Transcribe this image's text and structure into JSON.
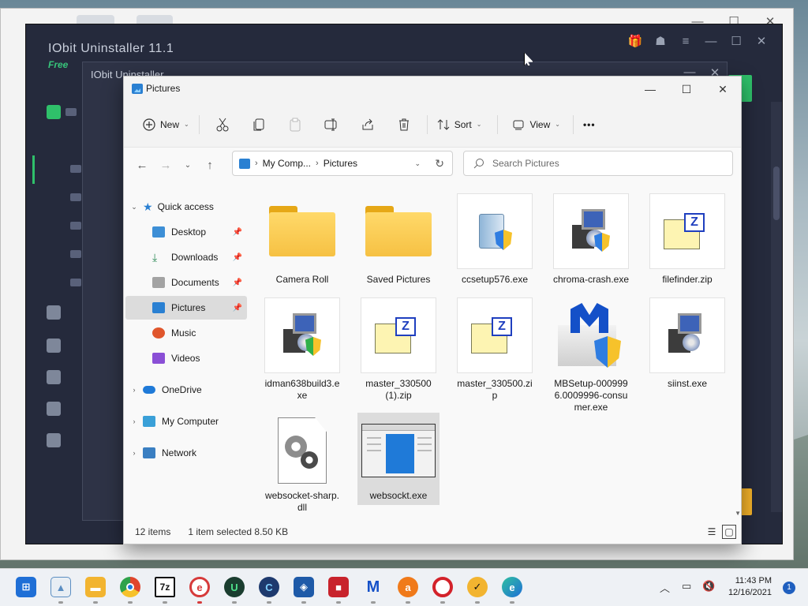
{
  "back_window": {
    "controls": [
      "—",
      "☐",
      "✕"
    ]
  },
  "iobit": {
    "title": "IObit Uninstaller 11.1",
    "edition": "Free",
    "controls": [
      "—",
      "☐",
      "✕"
    ],
    "dialog": {
      "title": "IObit Uninstaller",
      "controls": [
        "—",
        "✕"
      ]
    }
  },
  "explorer": {
    "title": "Pictures",
    "controls": [
      "—",
      "☐",
      "✕"
    ],
    "commands": {
      "new_label": "New",
      "sort_label": "Sort",
      "view_label": "View",
      "more_label": "•••"
    },
    "address": {
      "segments": [
        "My Comp...",
        "Pictures"
      ]
    },
    "search": {
      "placeholder": "Search Pictures"
    },
    "nav": {
      "quick_access": "Quick access",
      "items": [
        {
          "label": "Desktop",
          "icon": "desktop-icon",
          "color": "#3d8fd6",
          "pinned": true
        },
        {
          "label": "Downloads",
          "icon": "download-icon",
          "color": "#2e8b57",
          "pinned": true
        },
        {
          "label": "Documents",
          "icon": "documents-icon",
          "color": "#8a8a8a",
          "pinned": true
        },
        {
          "label": "Pictures",
          "icon": "pictures-icon",
          "color": "#2a80d2",
          "pinned": true,
          "selected": true
        },
        {
          "label": "Music",
          "icon": "music-icon",
          "color": "#e0562c",
          "pinned": false
        },
        {
          "label": "Videos",
          "icon": "videos-icon",
          "color": "#8a4fd6",
          "pinned": false
        }
      ],
      "roots": [
        {
          "label": "OneDrive",
          "icon": "onedrive-icon",
          "color": "#1f7ad8"
        },
        {
          "label": "My Computer",
          "icon": "computer-icon",
          "color": "#3aa0d8"
        },
        {
          "label": "Network",
          "icon": "network-icon",
          "color": "#3a7fc2"
        }
      ]
    },
    "files": [
      {
        "name": "Camera Roll",
        "type": "folder"
      },
      {
        "name": "Saved Pictures",
        "type": "folder"
      },
      {
        "name": "ccsetup576.exe",
        "type": "ccleaner"
      },
      {
        "name": "chroma-crash.exe",
        "type": "setup"
      },
      {
        "name": "filefinder.zip",
        "type": "zip"
      },
      {
        "name": "idman638build3.exe",
        "type": "setup"
      },
      {
        "name": "master_330500 (1).zip",
        "type": "zip"
      },
      {
        "name": "master_330500.zip",
        "type": "zip"
      },
      {
        "name": "MBSetup-0009996.0009996-consumer.exe",
        "type": "malwarebytes"
      },
      {
        "name": "siinst.exe",
        "type": "setup"
      },
      {
        "name": "websocket-sharp.dll",
        "type": "dll"
      },
      {
        "name": "websockt.exe",
        "type": "window",
        "selected": true
      }
    ],
    "status": {
      "count": "12 items",
      "selection": "1 item selected  8.50 KB"
    }
  },
  "taskbar": {
    "apps": [
      {
        "name": "start",
        "label": "⊞",
        "color": "#1f6fd6"
      },
      {
        "name": "photos",
        "label": "▲",
        "color": "#5b8ec2"
      },
      {
        "name": "file-explorer",
        "label": "▬",
        "color": "#f2b430"
      },
      {
        "name": "chrome",
        "label": "●",
        "color": "#e0452c"
      },
      {
        "name": "7zip",
        "label": "7z",
        "color": "#222222"
      },
      {
        "name": "app-red",
        "label": "e",
        "color": "#d63a3a"
      },
      {
        "name": "uninstaller",
        "label": "U",
        "color": "#1a3d2f"
      },
      {
        "name": "ccleaner",
        "label": "C",
        "color": "#1e3a6e"
      },
      {
        "name": "defender",
        "label": "◈",
        "color": "#1e5aa8"
      },
      {
        "name": "recorder",
        "label": "■",
        "color": "#c8232c"
      },
      {
        "name": "malwarebytes",
        "label": "M",
        "color": "#1450c8"
      },
      {
        "name": "avast",
        "label": "a",
        "color": "#f07a1a"
      },
      {
        "name": "opera",
        "label": "O",
        "color": "#d3222a"
      },
      {
        "name": "norton",
        "label": "✓",
        "color": "#f2b430"
      },
      {
        "name": "edge",
        "label": "e",
        "color": "#1f8fd6"
      }
    ],
    "clock": {
      "time": "11:43 PM",
      "date": "12/16/2021"
    },
    "notifications": "1"
  }
}
